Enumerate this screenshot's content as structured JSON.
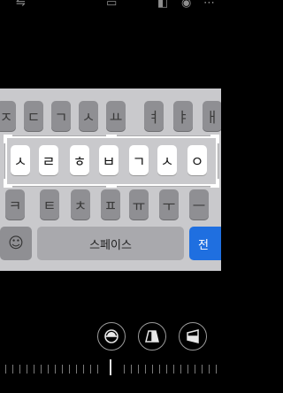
{
  "keyboard": {
    "row1": [
      "ㅈ",
      "ㄷ",
      "ㄱ",
      "ㅅ",
      "ㅛ",
      "ㅕ",
      "ㅑ",
      "ㅐ"
    ],
    "row2": [
      "ㅅ",
      "ㄹ",
      "ㅎ",
      "ㅂ",
      "ㄱ",
      "ㅅ",
      "ㅇ"
    ],
    "row3": [
      "ㅋ",
      "ㅌ",
      "ㅊ",
      "ㅍ",
      "ㅠ",
      "ㅜ",
      "ㅡ"
    ],
    "emoji_label": "☺",
    "space_label": "스페이스",
    "return_label": "전"
  },
  "icons": {
    "top_left": "flip-icon",
    "top_center": "aspect-icon",
    "top_right": "share-icon",
    "tool1": "straighten-icon",
    "tool2": "vertical-perspective-icon",
    "tool3": "horizontal-perspective-icon"
  }
}
